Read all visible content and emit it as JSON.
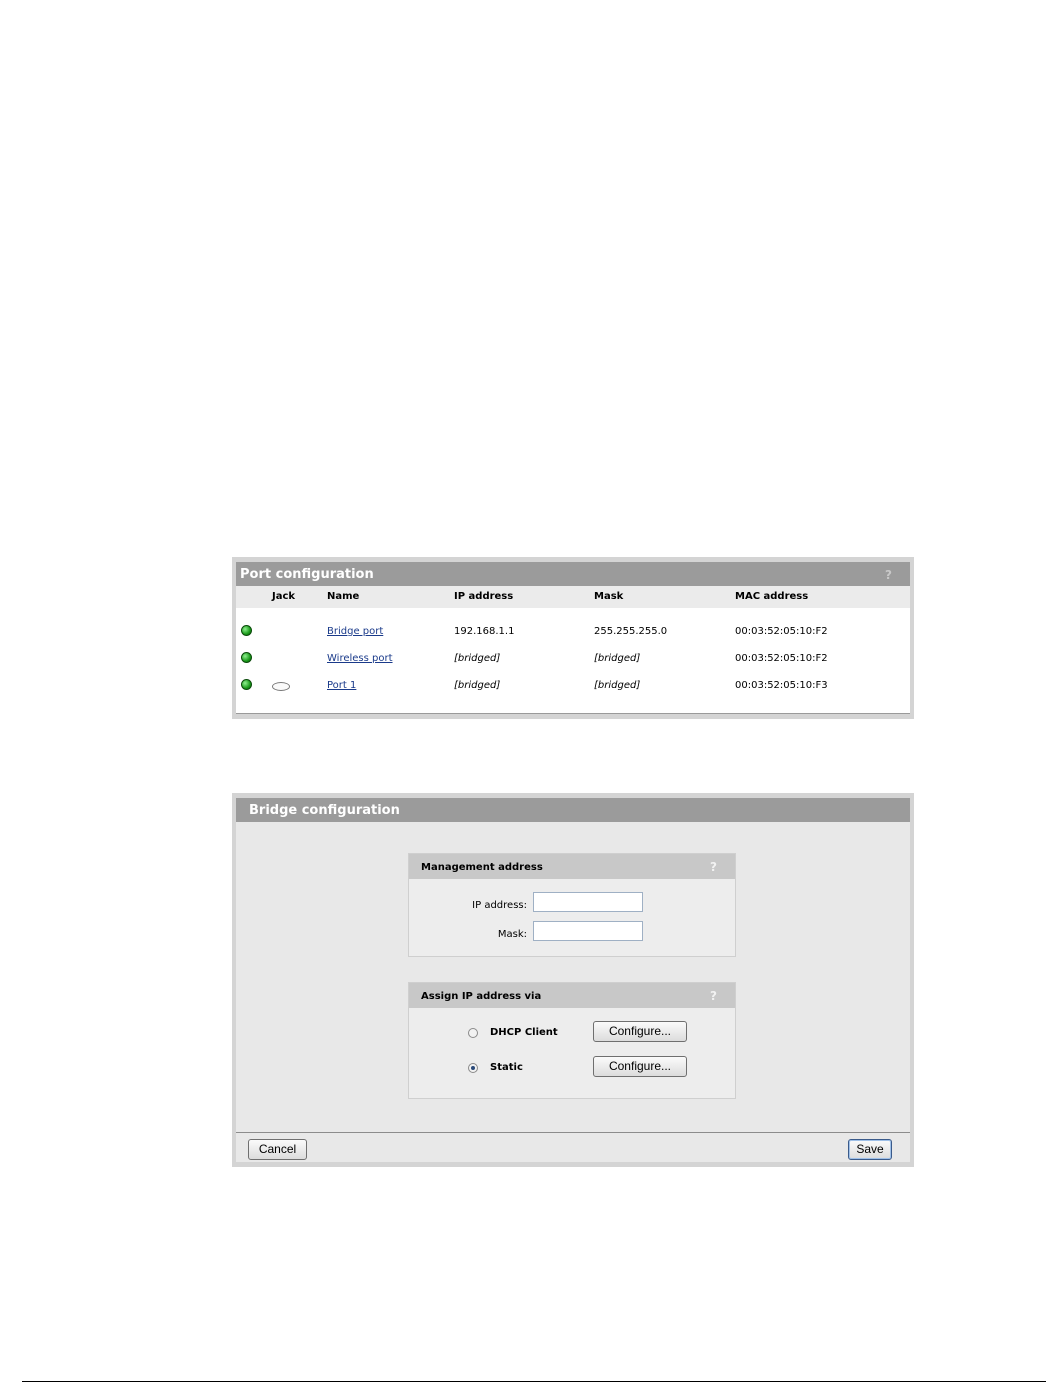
{
  "port_config": {
    "title": "Port configuration",
    "help": "?",
    "columns": {
      "jack": "Jack",
      "name": "Name",
      "ip": "IP address",
      "mask": "Mask",
      "mac": "MAC address"
    },
    "rows": [
      {
        "status": "up",
        "jack": "",
        "name": "Bridge port",
        "ip": "192.168.1.1",
        "mask": "255.255.255.0",
        "mac": "00:03:52:05:10:F2"
      },
      {
        "status": "up",
        "jack": "",
        "name": "Wireless port",
        "ip": "[bridged]",
        "mask": "[bridged]",
        "mac": "00:03:52:05:10:F2"
      },
      {
        "status": "up",
        "jack": "jack-icon",
        "name": "Port 1",
        "ip": "[bridged]",
        "mask": "[bridged]",
        "mac": "00:03:52:05:10:F3"
      }
    ]
  },
  "bridge_config": {
    "title": "Bridge configuration",
    "management": {
      "title": "Management address",
      "help": "?",
      "ip_label": "IP address:",
      "ip_value": "",
      "mask_label": "Mask:",
      "mask_value": ""
    },
    "assign": {
      "title": "Assign IP address via",
      "help": "?",
      "options": [
        {
          "label": "DHCP Client",
          "selected": false,
          "button": "Configure..."
        },
        {
          "label": "Static",
          "selected": true,
          "button": "Configure..."
        }
      ]
    },
    "cancel_label": "Cancel",
    "save_label": "Save"
  },
  "colors": {
    "title_bar": "#9b9b9b",
    "link": "#1a3a8a",
    "status_led": "#1a9a1a"
  }
}
